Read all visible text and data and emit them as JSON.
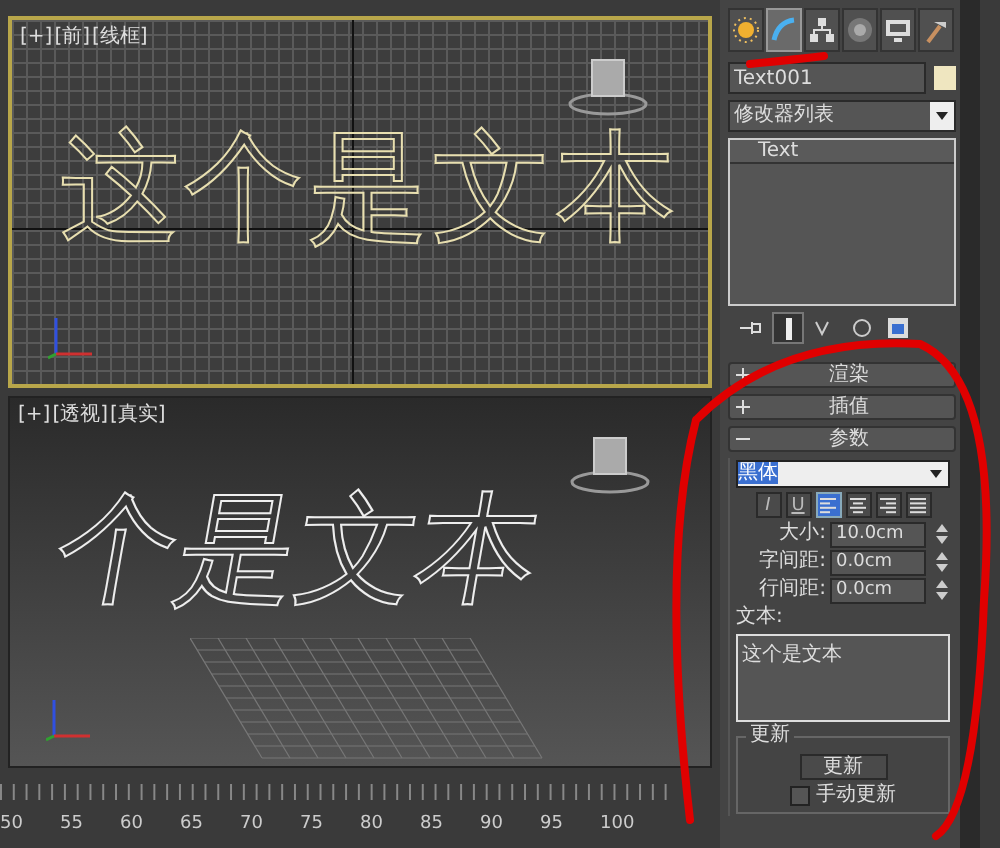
{
  "viewports": [
    {
      "kind": "front",
      "active": true,
      "labels": [
        "[+]",
        "[前]",
        "[线框]"
      ],
      "text": "这个是文本"
    },
    {
      "kind": "perspective",
      "active": false,
      "labels": [
        "[+]",
        "[透视]",
        "[真实]"
      ],
      "text": "个是文本"
    }
  ],
  "timeline": {
    "ticks": [
      "50",
      "55",
      "60",
      "65",
      "70",
      "75",
      "80",
      "85",
      "90",
      "95",
      "100"
    ]
  },
  "command_tabs": [
    {
      "kind": "create",
      "selected": false
    },
    {
      "kind": "modify",
      "selected": true
    },
    {
      "kind": "hierarchy",
      "selected": false
    },
    {
      "kind": "motion",
      "selected": false
    },
    {
      "kind": "display",
      "selected": false
    },
    {
      "kind": "utilities",
      "selected": false
    }
  ],
  "object_name": "Text001",
  "modifier_list": "修改器列表",
  "stack": [
    {
      "label": "Text",
      "selected": false
    }
  ],
  "stack_tools": [
    {
      "kind": "pin",
      "selected": false
    },
    {
      "kind": "show-end",
      "selected": true
    },
    {
      "kind": "unique",
      "selected": false
    },
    {
      "kind": "remove",
      "selected": false
    },
    {
      "kind": "configure",
      "selected": false
    }
  ],
  "rollouts": [
    {
      "title": "渲染",
      "expanded": false
    },
    {
      "title": "插值",
      "expanded": false
    },
    {
      "title": "参数",
      "expanded": true
    }
  ],
  "parameters": {
    "font": "黑体",
    "format_buttons": [
      {
        "kind": "italic",
        "label": "I",
        "selected": false
      },
      {
        "kind": "underline",
        "label": "U",
        "selected": false
      },
      {
        "kind": "align-left",
        "selected": true
      },
      {
        "kind": "align-center",
        "selected": false
      },
      {
        "kind": "align-right",
        "selected": false
      },
      {
        "kind": "justify",
        "selected": false
      }
    ],
    "spinners": [
      {
        "label": "大小:",
        "value": "10.0cm"
      },
      {
        "label": "字间距:",
        "value": "0.0cm"
      },
      {
        "label": "行间距:",
        "value": "0.0cm"
      }
    ],
    "text_label": "文本:",
    "text_value": "这个是文本",
    "update_group": {
      "title": "更新",
      "button": "更新",
      "manual_update": {
        "label": "手动更新",
        "checked": false
      }
    }
  },
  "annotations": {
    "tab_underline": true,
    "panel_circle": true
  }
}
